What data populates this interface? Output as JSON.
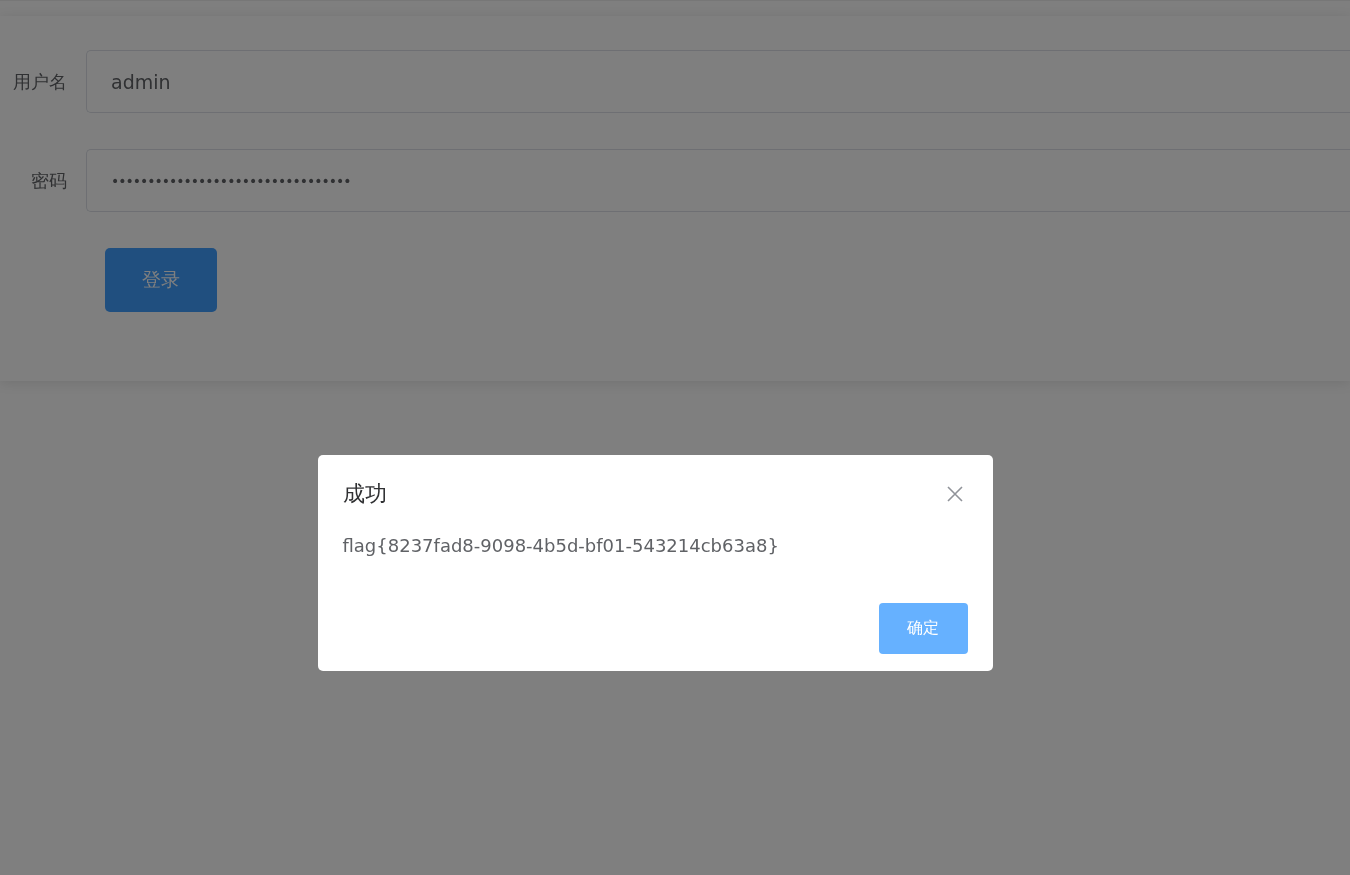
{
  "login_form": {
    "fields": [
      {
        "label": "用户名",
        "kind": "text",
        "value": "admin"
      },
      {
        "label": "密码",
        "kind": "password",
        "value": "•••••••••••••••••••••••••••••••••"
      }
    ],
    "submit_button": "登录"
  },
  "dialog": {
    "title": "成功",
    "message": "flag{8237fad8-9098-4b5d-bf01-543214cb63a8}",
    "confirm_button": "确定"
  }
}
